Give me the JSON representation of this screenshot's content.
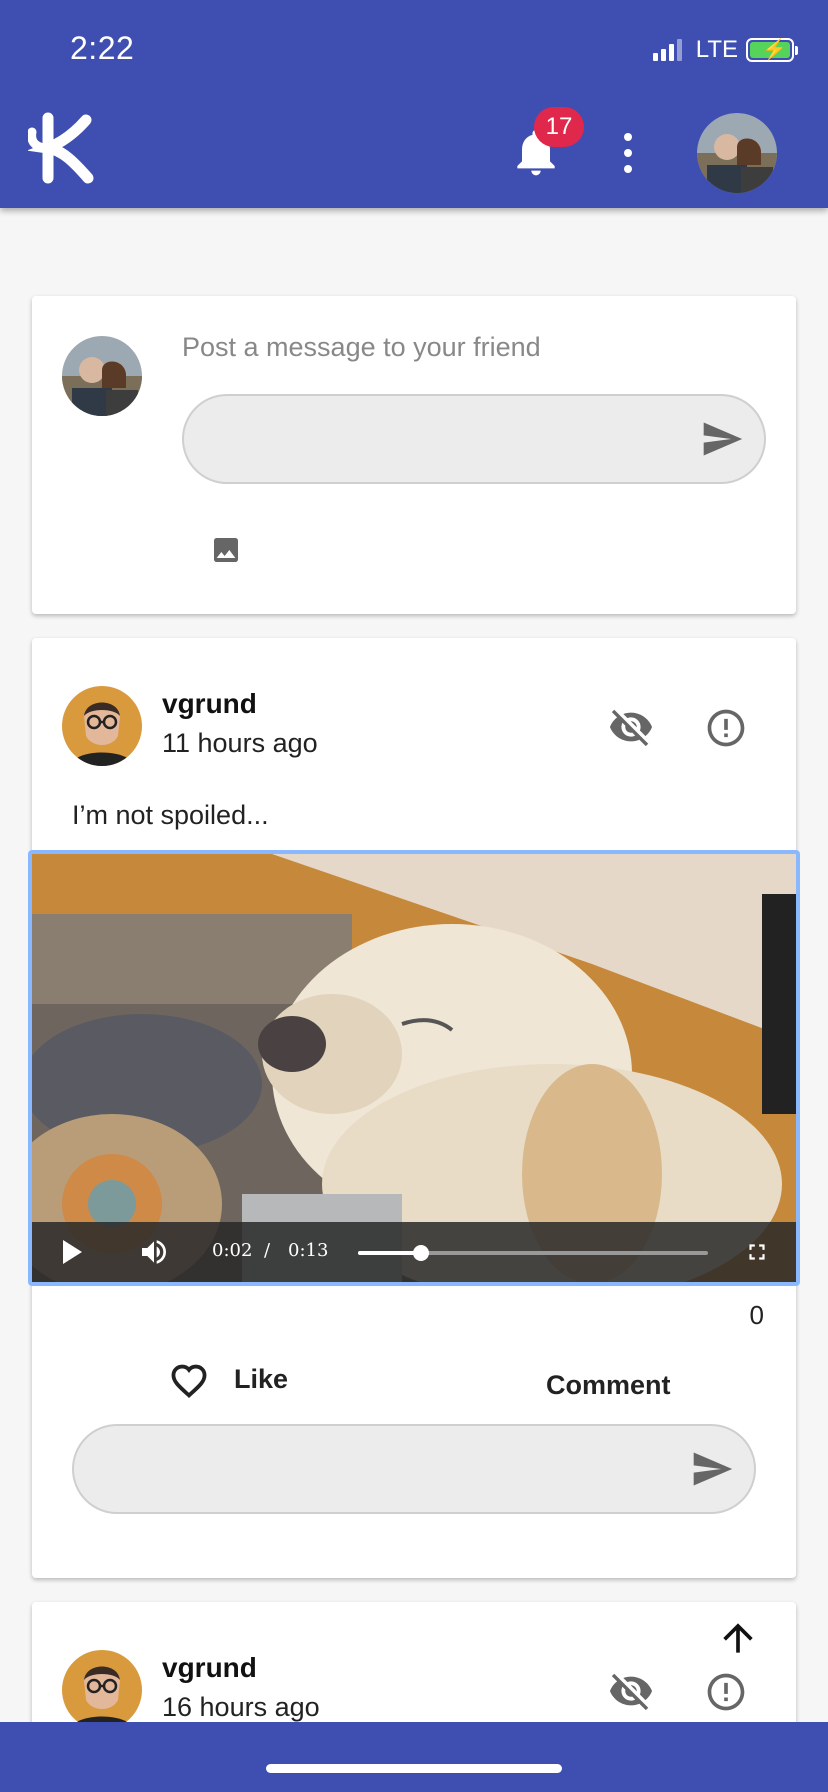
{
  "status_bar": {
    "time": "2:22",
    "network": "LTE"
  },
  "app_bar": {
    "notification_count": "17"
  },
  "composer": {
    "prompt": "Post a message to your friend",
    "input_value": ""
  },
  "posts": [
    {
      "author": "vgrund",
      "time": "11 hours ago",
      "text": "I’m not spoiled...",
      "video": {
        "current_time": "0:02",
        "separator": "/",
        "duration": "0:13",
        "progress_fraction": 0.18
      },
      "like_count": "0",
      "like_label": "Like",
      "comment_label": "Comment",
      "comment_value": ""
    },
    {
      "author": "vgrund",
      "time": "16 hours ago"
    }
  ],
  "icons": [
    "logo-icon",
    "bell-icon",
    "more-vert-icon",
    "send-icon",
    "image-icon",
    "visibility-off-icon",
    "report-icon",
    "play-icon",
    "volume-icon",
    "fullscreen-icon",
    "heart-icon",
    "arrow-up-icon"
  ],
  "colors": {
    "primary": "#3f4fb1",
    "badge": "#e0284d",
    "video_focus": "#8ab8ff",
    "battery": "#56d35a"
  }
}
